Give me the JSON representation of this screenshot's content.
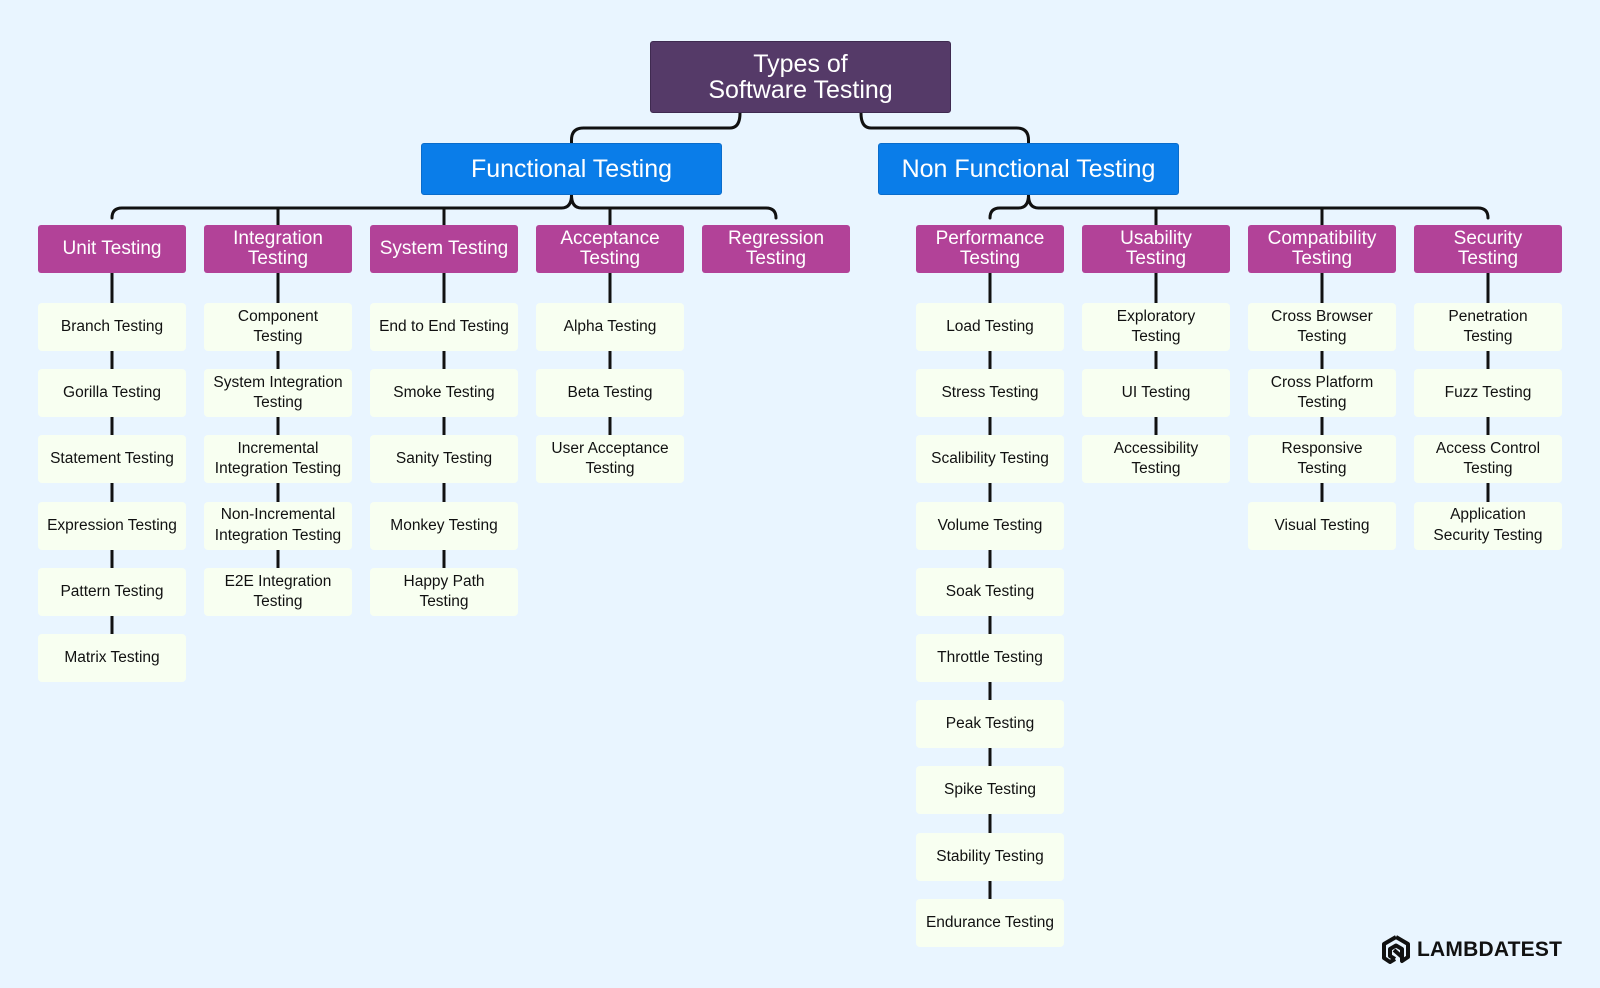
{
  "title": "Types of\nSoftware Testing",
  "colors": {
    "background": "#e9f5ff",
    "root": "#553a68",
    "branch": "#0a7de9",
    "category": "#b24298",
    "leaf": "#f8fff1",
    "connector": "#111111"
  },
  "branches": [
    {
      "label": "Functional Testing",
      "categories": [
        {
          "label": "Unit Testing",
          "items": [
            "Branch Testing",
            "Gorilla Testing",
            "Statement Testing",
            "Expression Testing",
            "Pattern Testing",
            "Matrix Testing"
          ]
        },
        {
          "label": "Integration\nTesting",
          "items": [
            "Component\nTesting",
            "System Integration\nTesting",
            "Incremental\nIntegration Testing",
            "Non-Incremental\nIntegration Testing",
            "E2E Integration\nTesting"
          ]
        },
        {
          "label": "System Testing",
          "items": [
            "End to End Testing",
            "Smoke Testing",
            "Sanity Testing",
            "Monkey Testing",
            "Happy Path\nTesting"
          ]
        },
        {
          "label": "Acceptance\nTesting",
          "items": [
            "Alpha Testing",
            "Beta Testing",
            "User Acceptance\nTesting"
          ]
        },
        {
          "label": "Regression\nTesting",
          "items": []
        }
      ]
    },
    {
      "label": "Non Functional Testing",
      "categories": [
        {
          "label": "Performance\nTesting",
          "items": [
            "Load Testing",
            "Stress Testing",
            "Scalibility Testing",
            "Volume Testing",
            "Soak Testing",
            "Throttle Testing",
            "Peak Testing",
            "Spike Testing",
            "Stability Testing",
            "Endurance Testing"
          ]
        },
        {
          "label": "Usability\nTesting",
          "items": [
            "Exploratory\nTesting",
            "UI Testing",
            "Accessibility\nTesting"
          ]
        },
        {
          "label": "Compatibility\nTesting",
          "items": [
            "Cross Browser\nTesting",
            "Cross Platform\nTesting",
            "Responsive\nTesting",
            "Visual Testing"
          ]
        },
        {
          "label": "Security\nTesting",
          "items": [
            "Penetration\nTesting",
            "Fuzz Testing",
            "Access Control\nTesting",
            "Application\nSecurity Testing"
          ]
        }
      ]
    }
  ],
  "logo": {
    "text": "LAMBDATEST",
    "icon": "lambdatest-logo-icon"
  }
}
